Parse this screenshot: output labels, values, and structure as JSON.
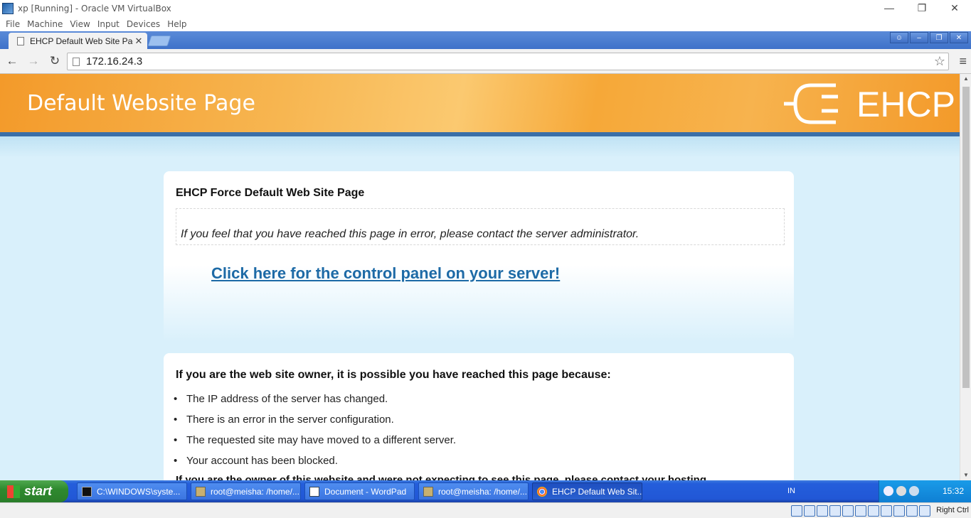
{
  "host_window": {
    "title": "xp [Running] - Oracle VM VirtualBox",
    "menu": [
      "File",
      "Machine",
      "View",
      "Input",
      "Devices",
      "Help"
    ],
    "controls": [
      "—",
      "❐",
      "✕"
    ]
  },
  "browser": {
    "tab_title": "EHCP Default Web Site Page",
    "tab_close": "✕",
    "window_controls": [
      "☺",
      "–",
      "❐",
      "✕"
    ],
    "nav": {
      "back": "←",
      "forward": "→",
      "reload": "↻"
    },
    "url": "172.16.24.3",
    "star": "☆",
    "menu": "≡"
  },
  "page": {
    "banner_title": "Default Website Page",
    "logo_text": "EHCP",
    "card1": {
      "heading": "EHCP Force Default Web Site Page",
      "notice": "If you feel that you have reached this page in error, please contact the server administrator.",
      "control_panel_link": "Click here for the control panel on your server!"
    },
    "card2": {
      "heading": "If you are the web site owner, it is possible you have reached this page because:",
      "reasons": [
        "The IP address of the server has changed.",
        "There is an error in the server configuration.",
        "The requested site may have moved to a different server.",
        "Your account has been blocked."
      ],
      "footer_note": "If you are the owner of this website and were not expecting to see this page, please contact your hosting"
    }
  },
  "taskbar": {
    "start_label": "start",
    "tasks": [
      {
        "label": "C:\\WINDOWS\\syste...",
        "icon": "cmd-icon"
      },
      {
        "label": "root@meisha: /home/...",
        "icon": "putty-icon"
      },
      {
        "label": "Document - WordPad",
        "icon": "wordpad-icon"
      },
      {
        "label": "root@meisha: /home/...",
        "icon": "putty-icon"
      },
      {
        "label": "EHCP Default Web Sit...",
        "icon": "chrome-icon"
      }
    ],
    "language": "IN",
    "clock": "15:32"
  },
  "status_bar": {
    "host_key": "Right Ctrl"
  },
  "colors": {
    "banner_orange": "#f39a2a",
    "page_bg": "#d9f0fb",
    "link_blue": "#1d6aa6",
    "taskbar_blue": "#245edb",
    "start_green": "#2f8a2f"
  }
}
